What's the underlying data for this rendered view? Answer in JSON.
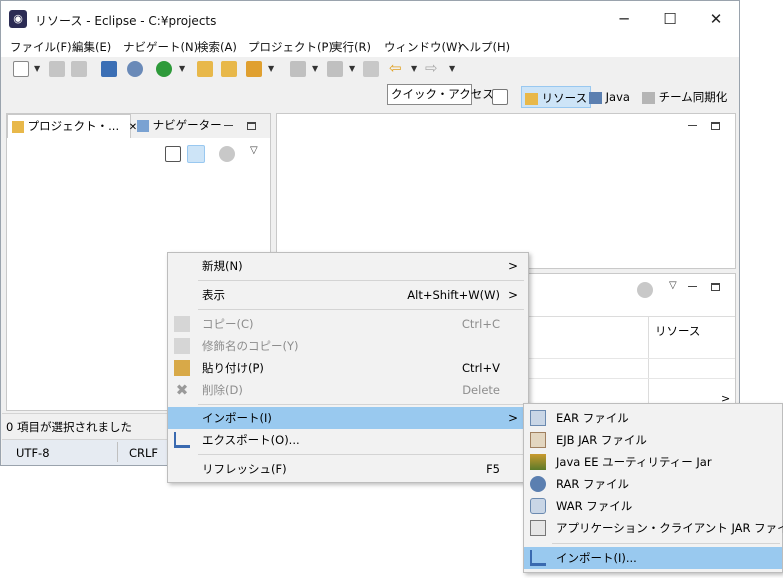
{
  "window": {
    "title": "リソース - Eclipse - C:¥projects",
    "minimize": "─",
    "maximize": "☐",
    "close": "✕"
  },
  "menubar": [
    "ファイル(F)",
    "編集(E)",
    "ナビゲート(N)",
    "検索(A)",
    "プロジェクト(P)",
    "実行(R)",
    "ウィンドウ(W)",
    "ヘルプ(H)"
  ],
  "toolbar": {
    "quick_access": "クイック・アクセス"
  },
  "perspectives": {
    "resource": "リソース",
    "java": "Java",
    "team_sync": "チーム同期化"
  },
  "left_panel": {
    "tab_project_explorer": "プロジェクト・...",
    "tab_close": "✕",
    "tab_navigator": "ナビゲーター"
  },
  "bottom_panel": {
    "column_resource": "リソース",
    "scroll_right": ">"
  },
  "statusbar": {
    "selection": "0 項目が選択されました",
    "encoding": "UTF-8",
    "line_ending": "CRLF"
  },
  "context_menu": {
    "new": {
      "label": "新規(N)",
      "sub": ">"
    },
    "show": {
      "label": "表示",
      "shortcut": "Alt+Shift+W(W)",
      "sub": ">"
    },
    "copy": {
      "label": "コピー(C)",
      "shortcut": "Ctrl+C"
    },
    "copy_qualified": {
      "label": "修飾名のコピー(Y)"
    },
    "paste": {
      "label": "貼り付け(P)",
      "shortcut": "Ctrl+V"
    },
    "delete": {
      "label": "削除(D)",
      "shortcut": "Delete"
    },
    "import": {
      "label": "インポート(I)",
      "sub": ">"
    },
    "export": {
      "label": "エクスポート(O)..."
    },
    "refresh": {
      "label": "リフレッシュ(F)",
      "shortcut": "F5"
    }
  },
  "import_submenu": {
    "ear": "EAR ファイル",
    "ejb_jar": "EJB JAR ファイル",
    "javaee_util": "Java EE ユーティリティー Jar",
    "rar": "RAR ファイル",
    "war": "WAR ファイル",
    "app_client": "アプリケーション・クライアント JAR ファイル",
    "import": "インポート(I)..."
  },
  "colors": {
    "highlight": "#99c9ef",
    "persp_active": "#cde4f7",
    "disabled_text": "#8d8d8d"
  }
}
